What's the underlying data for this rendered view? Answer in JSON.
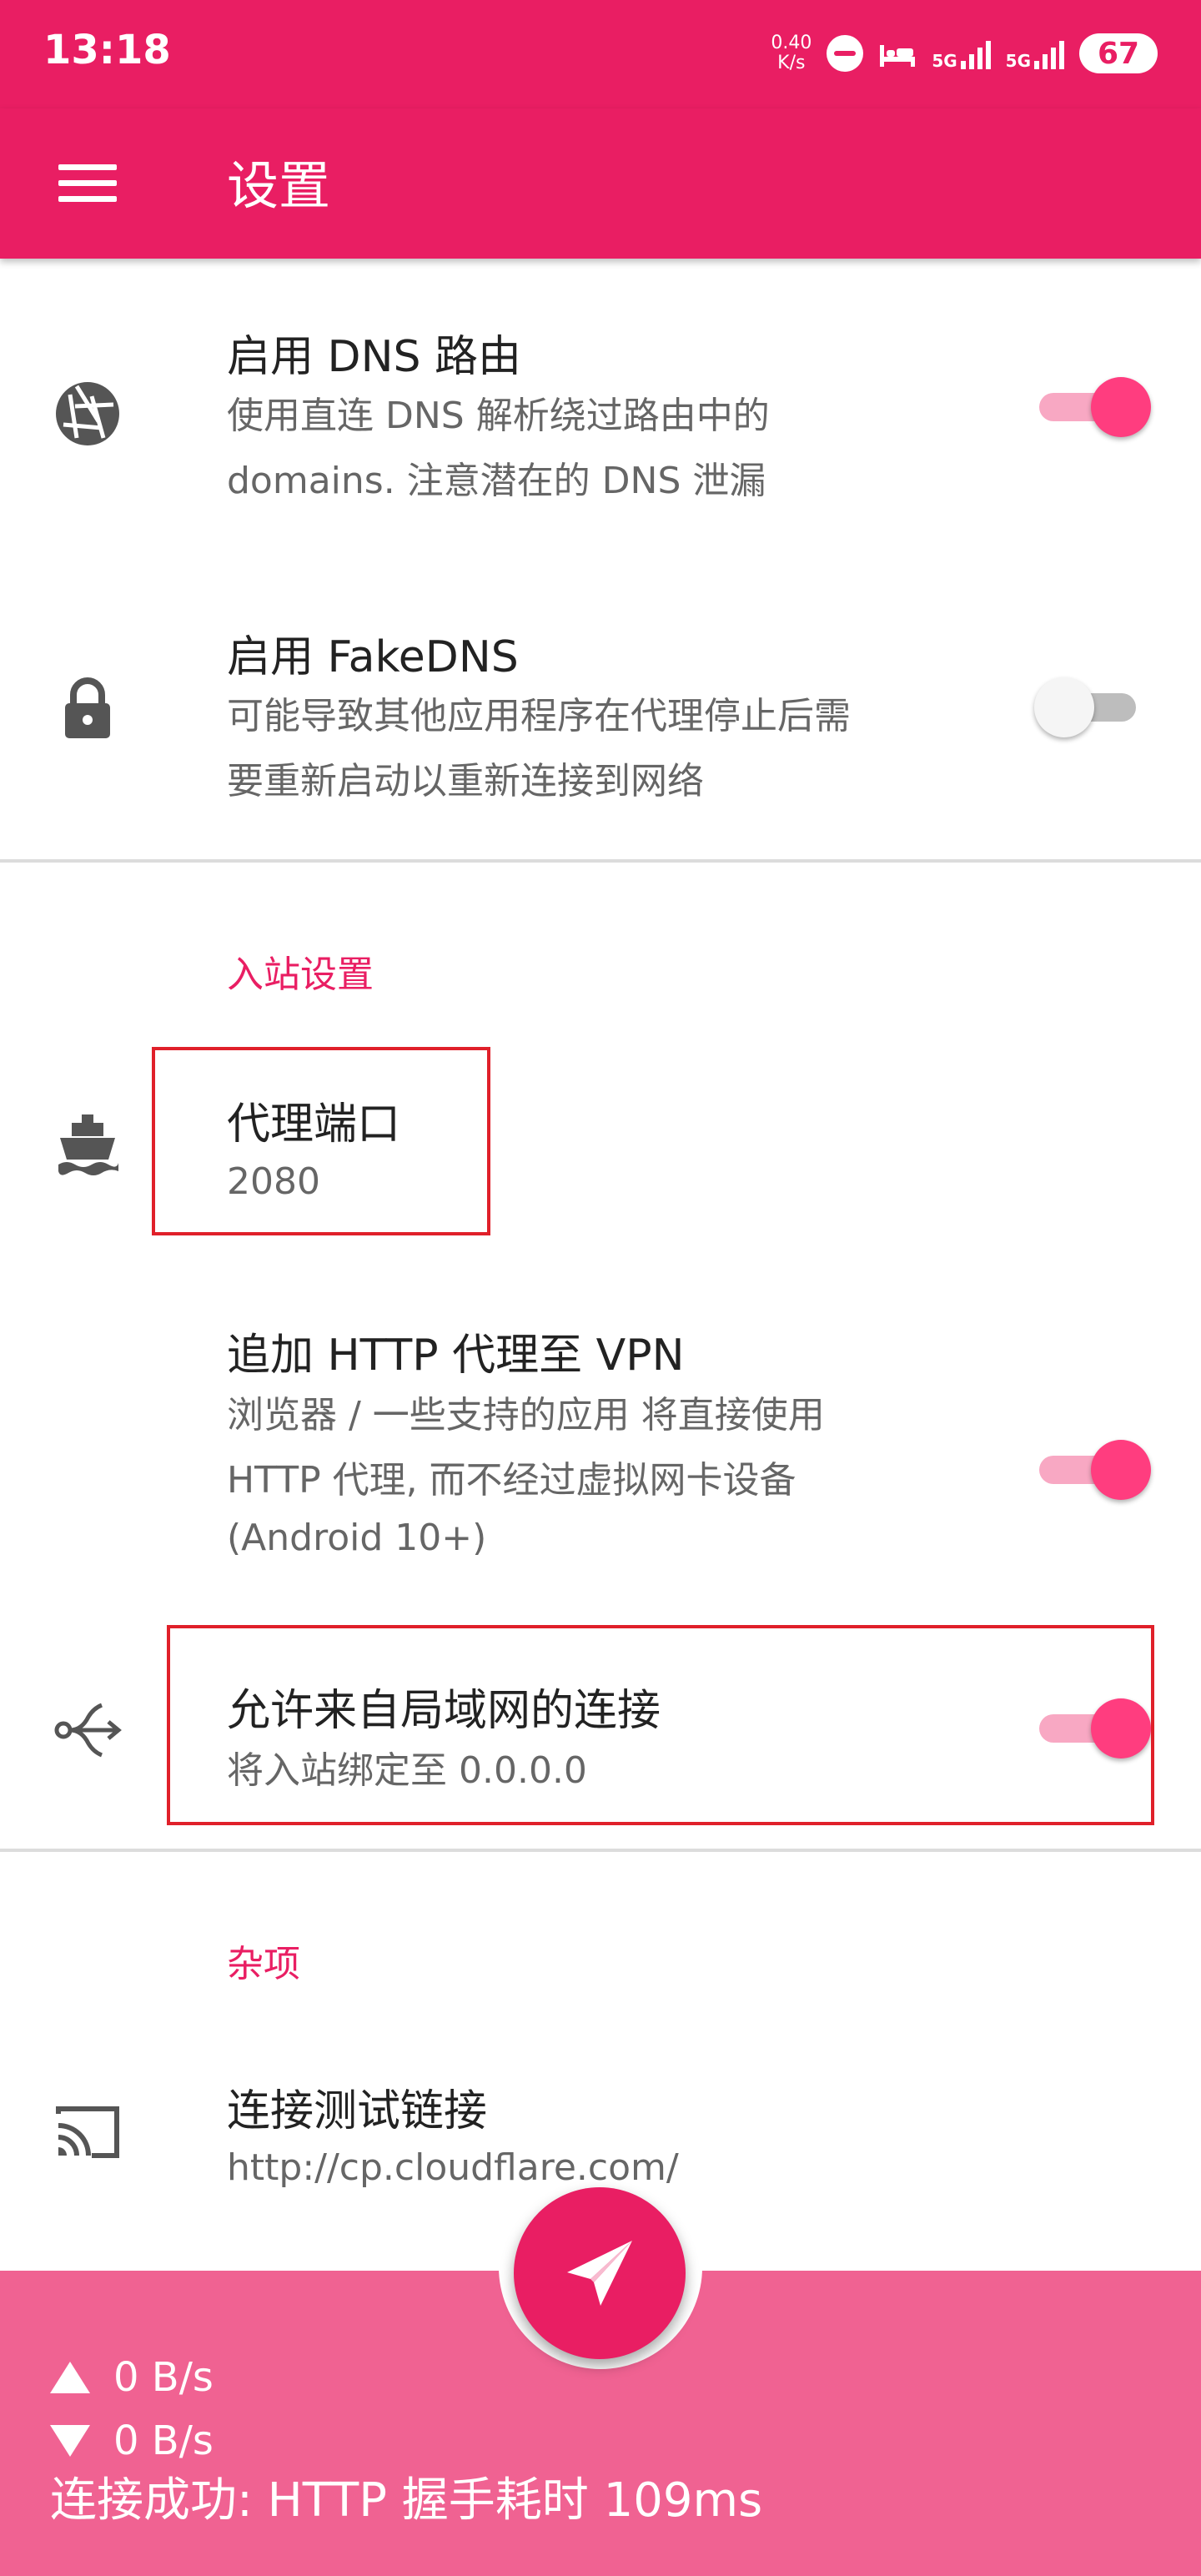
{
  "status_bar": {
    "time": "13:18",
    "net_speed_value": "0.40",
    "net_speed_unit": "K/s",
    "signal_1": "5G",
    "signal_2": "5G",
    "battery": "67"
  },
  "app_bar": {
    "menu_icon": "menu-icon",
    "title": "设置"
  },
  "settings": {
    "dns_routing": {
      "icon": "aperture-icon",
      "title": "启用 DNS 路由",
      "summary_line1": "使用直连 DNS 解析绕过路由中的",
      "summary_line2": "domains. 注意潜在的 DNS 泄漏",
      "enabled": true
    },
    "fake_dns": {
      "icon": "lock-icon",
      "title": "启用 FakeDNS",
      "summary_line1": "可能导致其他应用程序在代理停止后需",
      "summary_line2": "要重新启动以重新连接到网络",
      "enabled": false
    },
    "inbound_category": "入站设置",
    "proxy_port": {
      "icon": "ship-icon",
      "title": "代理端口",
      "value": "2080"
    },
    "http_proxy_vpn": {
      "title": "追加 HTTP 代理至 VPN",
      "summary_line1": "浏览器 / 一些支持的应用 将直接使用",
      "summary_line2": "HTTP 代理, 而不经过虚拟网卡设备",
      "summary_line3": "(Android 10+)",
      "enabled": true
    },
    "allow_lan": {
      "icon": "split-arrow-icon",
      "title": "允许来自局域网的连接",
      "summary": "将入站绑定至 0.0.0.0",
      "enabled": true
    },
    "misc_category": "杂项",
    "connection_test_url": {
      "icon": "cast-icon",
      "title": "连接测试链接",
      "value": "http://cp.cloudflare.com/"
    }
  },
  "footer": {
    "upload": "0 B/s",
    "download": "0 B/s",
    "status": "连接成功: HTTP 握手耗时 109ms"
  },
  "fab": {
    "icon": "send-icon"
  },
  "colors": {
    "primary": "#e91e63",
    "footer": "#f06292",
    "switch_on": "#ff3d7f",
    "highlight": "#e0202a"
  }
}
